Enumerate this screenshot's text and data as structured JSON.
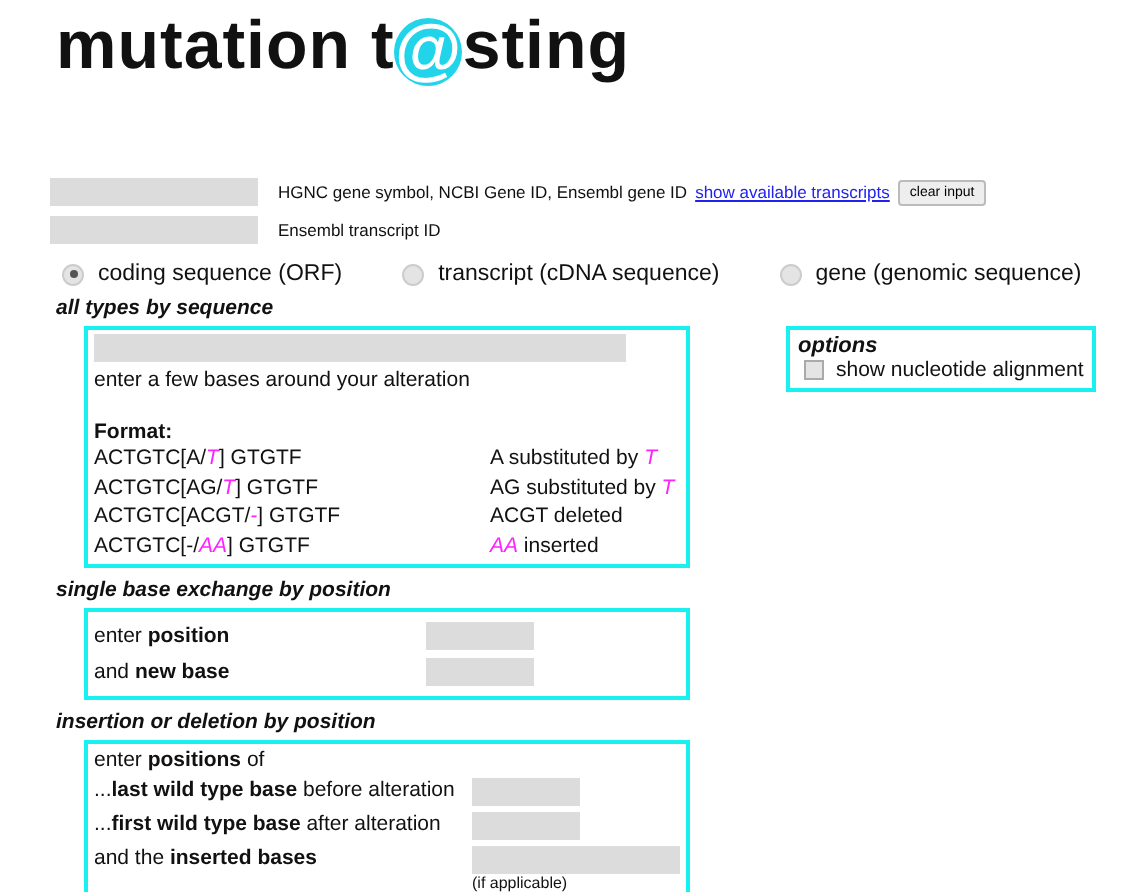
{
  "title": {
    "before": "mutation t",
    "mark": "@",
    "after": "sting"
  },
  "id_fields": [
    {
      "label": "HGNC gene symbol, NCBI Gene ID, Ensembl gene ID",
      "link": "show available transcripts",
      "button": "clear input"
    },
    {
      "label": "Ensembl transcript ID"
    }
  ],
  "sequence_types": [
    {
      "label": "coding sequence (ORF)",
      "selected": true
    },
    {
      "label": "transcript (cDNA sequence)",
      "selected": false
    },
    {
      "label": "gene (genomic sequence)",
      "selected": false
    }
  ],
  "by_sequence": {
    "heading": "all types by sequence",
    "hint": "enter a few bases around your alteration",
    "format_label": "Format:",
    "formats": [
      {
        "example": "ACTGTC[A/*T*] GTGTF",
        "meaning": "A substituted by *T*"
      },
      {
        "example": "ACTGTC[AG/*T*] GTGTF",
        "meaning": "AG substituted by *T*"
      },
      {
        "example": "ACTGTC[ACGT/*-*] GTGTF",
        "meaning": "ACGT deleted"
      },
      {
        "example": "ACTGTC[-/*AA*] GTGTF",
        "meaning": "*AA* inserted"
      }
    ]
  },
  "options": {
    "heading": "options",
    "items": [
      {
        "label": "show nucleotide alignment",
        "checked": false
      }
    ]
  },
  "single_base": {
    "heading": "single base exchange by position",
    "rows": [
      {
        "label": "enter **position**"
      },
      {
        "label": "and **new base**"
      }
    ]
  },
  "indel": {
    "heading": "insertion or deletion by position",
    "intro": "enter **positions** of",
    "rows": [
      {
        "label": "...**last wild type base** before alteration",
        "wide": false
      },
      {
        "label": "...**first wild type base** after alteration",
        "wide": false
      },
      {
        "label": "and the **inserted bases**",
        "wide": true,
        "note": "(if applicable)"
      }
    ]
  }
}
